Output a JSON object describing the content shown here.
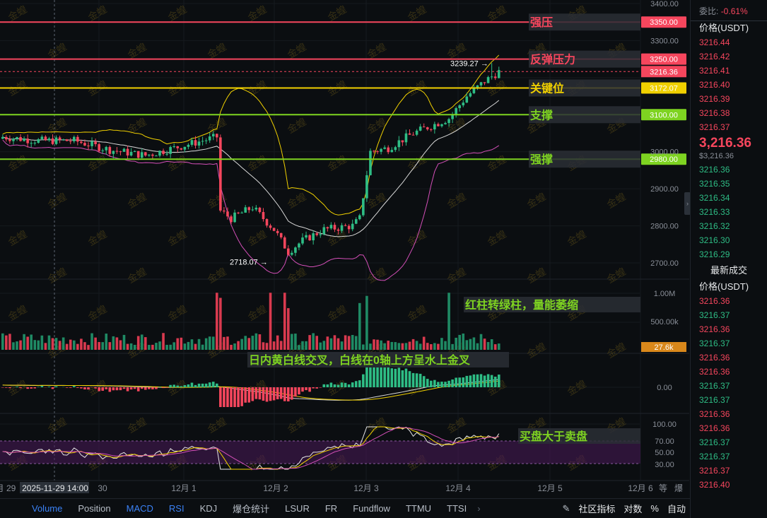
{
  "chart_data": {
    "type": "candlestick",
    "price_axis": {
      "ticks": [
        3400.0,
        3300.0,
        3000.0,
        2900.0,
        2800.0,
        2700.0
      ],
      "ylim": [
        2650,
        3400
      ]
    },
    "volume_axis": {
      "ticks": [
        "1.00M",
        "500.00k"
      ],
      "current_volume": "27.6k"
    },
    "macd_axis": {
      "ticks": [
        "0.00"
      ]
    },
    "rsi_axis": {
      "ticks": [
        "100.00",
        "70.00",
        "50.00",
        "30.00"
      ]
    },
    "x_ticks": [
      "月 29",
      "2025-11-29 14:00",
      "30",
      "12月 1",
      "12月 2",
      "12月 3",
      "12月 4",
      "12月 5",
      "12月 6"
    ],
    "current_price": "3216.36",
    "high_marker": "3239.27 →",
    "low_marker": "2718.07 →",
    "levels": [
      {
        "label": "强压",
        "price": "3350.00",
        "value": 3350.0,
        "color": "#f6465d"
      },
      {
        "label": "反弹压力",
        "price": "3250.00",
        "value": 3250.0,
        "color": "#f6465d"
      },
      {
        "label": "关键位",
        "price": "3172.07",
        "value": 3172.07,
        "color": "#f0d000"
      },
      {
        "label": "支撑",
        "price": "3100.00",
        "value": 3100.0,
        "color": "#7ed321"
      },
      {
        "label": "强撑",
        "price": "2980.00",
        "value": 2980.0,
        "color": "#7ed321"
      }
    ],
    "annotations": {
      "volume_note": "红柱转绿柱，量能萎缩",
      "macd_note": "日内黄白线交叉，白线在0轴上方呈水上金叉",
      "rsi_note": "买盘大于卖盘"
    },
    "watermark": "金蝗"
  },
  "order_book": {
    "commission_ratio_label": "委比:",
    "commission_ratio": "-0.61%",
    "price_header": "价格(USDT)",
    "asks": [
      "3216.44",
      "3216.42",
      "3216.41",
      "3216.40",
      "3216.39",
      "3216.38",
      "3216.37"
    ],
    "last_price": "3,216.36",
    "last_price_sub": "$3,216.36",
    "bids": [
      "3216.36",
      "3216.35",
      "3216.34",
      "3216.33",
      "3216.32",
      "3216.30",
      "3216.29"
    ],
    "trades_title": "最新成交",
    "trades_header": "价格(USDT)",
    "trades": [
      {
        "p": "3216.36",
        "c": "red"
      },
      {
        "p": "3216.37",
        "c": "green"
      },
      {
        "p": "3216.36",
        "c": "red"
      },
      {
        "p": "3216.37",
        "c": "green"
      },
      {
        "p": "3216.36",
        "c": "red"
      },
      {
        "p": "3216.36",
        "c": "red"
      },
      {
        "p": "3216.37",
        "c": "green"
      },
      {
        "p": "3216.37",
        "c": "green"
      },
      {
        "p": "3216.36",
        "c": "red"
      },
      {
        "p": "3216.36",
        "c": "red"
      },
      {
        "p": "3216.37",
        "c": "green"
      },
      {
        "p": "3216.37",
        "c": "green"
      },
      {
        "p": "3216.37",
        "c": "red"
      },
      {
        "p": "3216.40",
        "c": "red"
      }
    ]
  },
  "toolbar": {
    "indicators": [
      {
        "label": "Volume",
        "active": true
      },
      {
        "label": "Position",
        "active": false
      },
      {
        "label": "MACD",
        "active": true
      },
      {
        "label": "RSI",
        "active": true
      },
      {
        "label": "KDJ",
        "active": false
      },
      {
        "label": "爆仓统计",
        "active": false
      },
      {
        "label": "LSUR",
        "active": false
      },
      {
        "label": "FR",
        "active": false
      },
      {
        "label": "Fundflow",
        "active": false
      },
      {
        "label": "TTMU",
        "active": false
      },
      {
        "label": "TTSI",
        "active": false
      }
    ],
    "more_arrow": "›",
    "community_label": "社区指标",
    "log_label": "对数",
    "percent_label": "%",
    "auto_label": "自动",
    "right_extra": [
      "等",
      "爆"
    ]
  }
}
